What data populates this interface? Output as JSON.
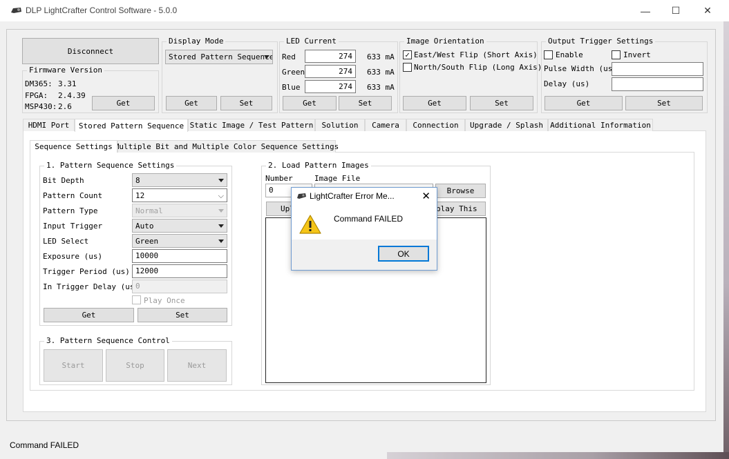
{
  "window": {
    "title": "DLP LightCrafter Control Software - 5.0.0",
    "minimize": "—",
    "maximize": "☐",
    "close": "✕"
  },
  "connection": {
    "disconnect_label": "Disconnect",
    "firmware_title": "Firmware Version",
    "dm365_label": "DM365:",
    "dm365_value": "3.31",
    "fpga_label": "FPGA:",
    "fpga_value": "2.4.39",
    "msp430_label": "MSP430:",
    "msp430_value": "2.6",
    "get_label": "Get"
  },
  "display_mode": {
    "title": "Display Mode",
    "selected": "Stored Pattern Sequence",
    "get_label": "Get",
    "set_label": "Set"
  },
  "led_current": {
    "title": "LED Current",
    "rows": [
      {
        "label": "Red",
        "value": "274",
        "ma": "633 mA"
      },
      {
        "label": "Green",
        "value": "274",
        "ma": "633 mA"
      },
      {
        "label": "Blue",
        "value": "274",
        "ma": "633 mA"
      }
    ],
    "get_label": "Get",
    "set_label": "Set"
  },
  "orientation": {
    "title": "Image Orientation",
    "ew_label": "East/West Flip (Short Axis)",
    "ew_checked": "✓",
    "ns_label": "North/South Flip (Long Axis)",
    "get_label": "Get",
    "set_label": "Set"
  },
  "trigger": {
    "title": "Output Trigger Settings",
    "enable_label": "Enable",
    "invert_label": "Invert",
    "pulse_label": "Pulse Width (us)",
    "delay_label": "Delay (us)",
    "pulse_value": "",
    "delay_value": "",
    "get_label": "Get",
    "set_label": "Set"
  },
  "tabs": [
    "HDMI Port",
    "Stored Pattern Sequence",
    "Static Image / Test Pattern",
    "Solution",
    "Camera",
    "Connection",
    "Upgrade / Splash",
    "Additional Information"
  ],
  "subtabs": [
    "Sequence Settings",
    "Multiple Bit and Multiple Color Sequence Settings"
  ],
  "pattern_settings": {
    "title": "1. Pattern Sequence Settings",
    "bit_depth_label": "Bit Depth",
    "bit_depth_value": "8",
    "pattern_count_label": "Pattern Count",
    "pattern_count_value": "12",
    "pattern_type_label": "Pattern Type",
    "pattern_type_value": "Normal",
    "input_trigger_label": "Input Trigger",
    "input_trigger_value": "Auto",
    "led_select_label": "LED Select",
    "led_select_value": "Green",
    "exposure_label": "Exposure (us)",
    "exposure_value": "10000",
    "trigger_period_label": "Trigger Period (us)",
    "trigger_period_value": "12000",
    "in_trigger_delay_label": "In Trigger Delay (us)",
    "in_trigger_delay_value": "0",
    "play_once_label": "Play Once",
    "get_label": "Get",
    "set_label": "Set"
  },
  "load_images": {
    "title": "2. Load Pattern Images",
    "number_label": "Number",
    "image_file_label": "Image File",
    "number_value": "0",
    "browse_label": "Browse",
    "upload_label": "Upl",
    "display_label": "play This"
  },
  "sequence_control": {
    "title": "3. Pattern Sequence Control",
    "start_label": "Start",
    "stop_label": "Stop",
    "next_label": "Next"
  },
  "dialog": {
    "title": "LightCrafter Error Me...",
    "message": "Command FAILED",
    "ok_label": "OK",
    "close": "✕"
  },
  "status": {
    "text": "Command FAILED"
  }
}
